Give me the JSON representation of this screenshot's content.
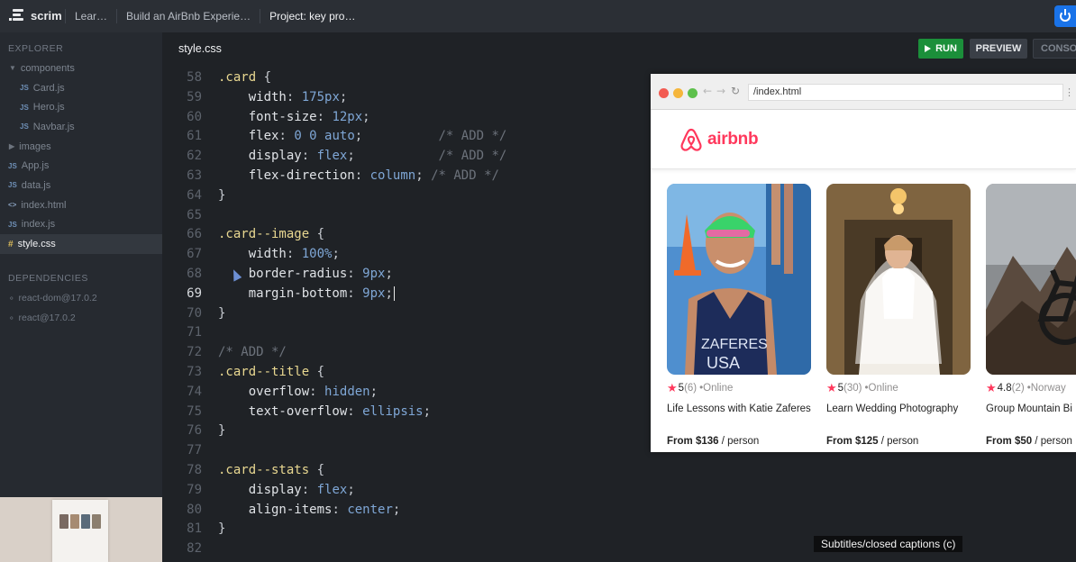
{
  "app": {
    "name": "scrim"
  },
  "breadcrumbs": [
    "Lear…",
    "Build an AirBnb Experie…",
    "Project: key pro…"
  ],
  "sidebar": {
    "explorer_label": "EXPLORER",
    "files": [
      {
        "label": "components",
        "type": "folder-open"
      },
      {
        "label": "Card.js",
        "type": "js"
      },
      {
        "label": "Hero.js",
        "type": "js"
      },
      {
        "label": "Navbar.js",
        "type": "js"
      },
      {
        "label": "images",
        "type": "folder-closed"
      },
      {
        "label": "App.js",
        "type": "js"
      },
      {
        "label": "data.js",
        "type": "js"
      },
      {
        "label": "index.html",
        "type": "html"
      },
      {
        "label": "index.js",
        "type": "js"
      },
      {
        "label": "style.css",
        "type": "css",
        "active": true
      }
    ],
    "deps_label": "DEPENDENCIES",
    "deps": [
      "react-dom@17.0.2",
      "react@17.0.2"
    ]
  },
  "editor": {
    "filename": "style.css",
    "run_label": "RUN",
    "preview_label": "PREVIEW",
    "console_label": "CONSO",
    "current_line": "69",
    "lines": [
      {
        "n": "58",
        "t": ".card {"
      },
      {
        "n": "59",
        "t": "    width: 175px;"
      },
      {
        "n": "60",
        "t": "    font-size: 12px;"
      },
      {
        "n": "61",
        "t": "    flex: 0 0 auto;          /* ADD */"
      },
      {
        "n": "62",
        "t": "    display: flex;           /* ADD */"
      },
      {
        "n": "63",
        "t": "    flex-direction: column; /* ADD */"
      },
      {
        "n": "64",
        "t": "}"
      },
      {
        "n": "65",
        "t": ""
      },
      {
        "n": "66",
        "t": ".card--image {"
      },
      {
        "n": "67",
        "t": "    width: 100%;"
      },
      {
        "n": "68",
        "t": "    border-radius: 9px;"
      },
      {
        "n": "69",
        "t": "    margin-bottom: 9px;"
      },
      {
        "n": "70",
        "t": "}"
      },
      {
        "n": "71",
        "t": ""
      },
      {
        "n": "72",
        "t": "/* ADD */"
      },
      {
        "n": "73",
        "t": ".card--title {"
      },
      {
        "n": "74",
        "t": "    overflow: hidden;"
      },
      {
        "n": "75",
        "t": "    text-overflow: ellipsis;"
      },
      {
        "n": "76",
        "t": "}"
      },
      {
        "n": "77",
        "t": ""
      },
      {
        "n": "78",
        "t": ".card--stats {"
      },
      {
        "n": "79",
        "t": "    display: flex;"
      },
      {
        "n": "80",
        "t": "    align-items: center;"
      },
      {
        "n": "81",
        "t": "}"
      },
      {
        "n": "82",
        "t": ""
      }
    ]
  },
  "preview": {
    "url": "/index.html",
    "brand": "airbnb",
    "cards": [
      {
        "rating": "5",
        "count": "(6)",
        "location": "•Online",
        "title": "Life Lessons with Katie Zaferes",
        "price": "From $136",
        "unit": " / person",
        "image": "swimmer-photo"
      },
      {
        "rating": "5",
        "count": "(30)",
        "location": "•Online",
        "title": "Learn Wedding Photography",
        "price": "From $125",
        "unit": " / person",
        "image": "wedding-photo"
      },
      {
        "rating": "4.8",
        "count": "(2)",
        "location": "•Norway",
        "title": "Group Mountain Bi",
        "price": "From $50",
        "unit": " / person",
        "image": "mountain-bike-photo"
      }
    ]
  },
  "caption": "Subtitles/closed captions (c)",
  "colors": {
    "run": "#1b8f3a",
    "brand": "#ff385c",
    "selector": "#e9d891",
    "value": "#7fa7d6",
    "comment": "#6c727b"
  }
}
